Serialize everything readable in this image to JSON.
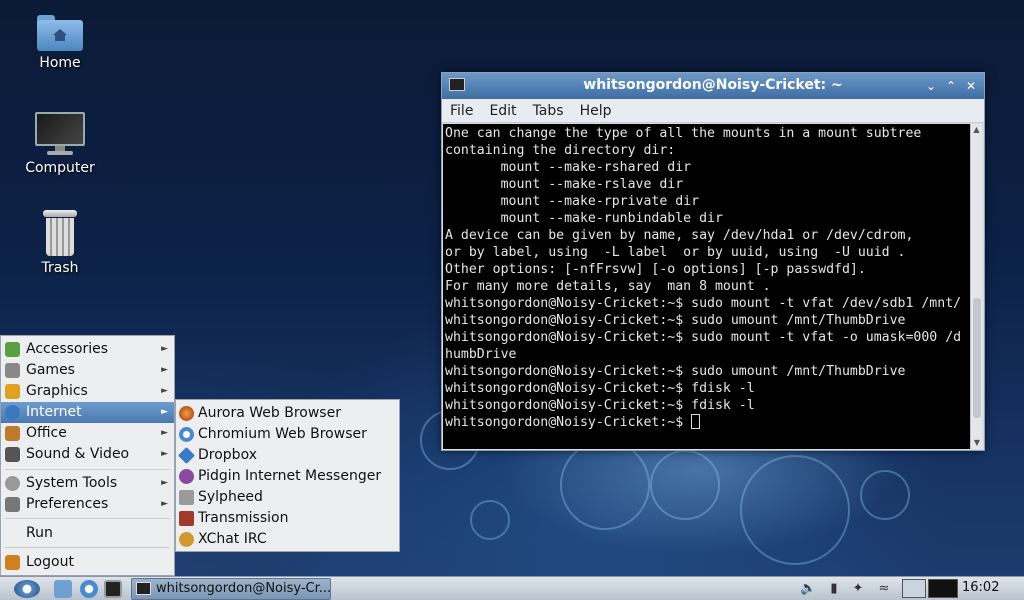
{
  "desktop": {
    "icons": [
      {
        "label": "Home",
        "icon": "home-folder-icon"
      },
      {
        "label": "Computer",
        "icon": "computer-icon"
      },
      {
        "label": "Trash",
        "icon": "trash-icon"
      }
    ]
  },
  "terminal": {
    "title": "whitsongordon@Noisy-Cricket: ~",
    "menu": [
      "File",
      "Edit",
      "Tabs",
      "Help"
    ],
    "lines": [
      "One can change the type of all the mounts in a mount subtree",
      "containing the directory dir:",
      "       mount --make-rshared dir",
      "       mount --make-rslave dir",
      "       mount --make-rprivate dir",
      "       mount --make-runbindable dir",
      "A device can be given by name, say /dev/hda1 or /dev/cdrom,",
      "or by label, using  -L label  or by uuid, using  -U uuid .",
      "Other options: [-nfFrsvw] [-o options] [-p passwdfd].",
      "For many more details, say  man 8 mount .",
      "whitsongordon@Noisy-Cricket:~$ sudo mount -t vfat /dev/sdb1 /mnt/",
      "whitsongordon@Noisy-Cricket:~$ sudo umount /mnt/ThumbDrive",
      "whitsongordon@Noisy-Cricket:~$ sudo mount -t vfat -o umask=000 /d",
      "humbDrive",
      "whitsongordon@Noisy-Cricket:~$ sudo umount /mnt/ThumbDrive",
      "whitsongordon@Noisy-Cricket:~$ fdisk -l",
      "whitsongordon@Noisy-Cricket:~$ fdisk -l"
    ],
    "prompt": "whitsongordon@Noisy-Cricket:~$ "
  },
  "start_menu": {
    "items": [
      {
        "label": "Accessories",
        "icon": "accessories-icon",
        "submenu": true,
        "color": "#5aa040"
      },
      {
        "label": "Games",
        "icon": "games-icon",
        "submenu": true,
        "color": "#888888"
      },
      {
        "label": "Graphics",
        "icon": "graphics-icon",
        "submenu": true,
        "color": "#e0a020"
      },
      {
        "label": "Internet",
        "icon": "internet-icon",
        "submenu": true,
        "active": true,
        "color": "#3a78c0"
      },
      {
        "label": "Office",
        "icon": "office-icon",
        "submenu": true,
        "color": "#c07a30"
      },
      {
        "label": "Sound & Video",
        "icon": "sound-video-icon",
        "submenu": true,
        "color": "#555555"
      },
      {
        "label": "System Tools",
        "icon": "system-tools-icon",
        "submenu": true,
        "color": "#999999"
      },
      {
        "label": "Preferences",
        "icon": "preferences-icon",
        "submenu": true,
        "color": "#777777"
      },
      {
        "label": "Run",
        "icon": "",
        "submenu": false
      },
      {
        "label": "Logout",
        "icon": "logout-icon",
        "submenu": false,
        "color": "#d08020"
      }
    ]
  },
  "internet_submenu": {
    "items": [
      {
        "label": "Aurora Web Browser",
        "icon": "aurora-icon",
        "color": "#d0601a"
      },
      {
        "label": "Chromium Web Browser",
        "icon": "chromium-icon",
        "color": "#4a8ad0"
      },
      {
        "label": "Dropbox",
        "icon": "dropbox-icon",
        "color": "#3a7ac8"
      },
      {
        "label": "Pidgin Internet Messenger",
        "icon": "pidgin-icon",
        "color": "#8a4aa0"
      },
      {
        "label": "Sylpheed",
        "icon": "sylpheed-icon",
        "color": "#9a9a9a"
      },
      {
        "label": "Transmission",
        "icon": "transmission-icon",
        "color": "#a03a2a"
      },
      {
        "label": "XChat IRC",
        "icon": "xchat-icon",
        "color": "#d09a30"
      }
    ]
  },
  "taskbar": {
    "task_label": "whitsongordon@Noisy-Cr...",
    "clock": "16:02"
  }
}
